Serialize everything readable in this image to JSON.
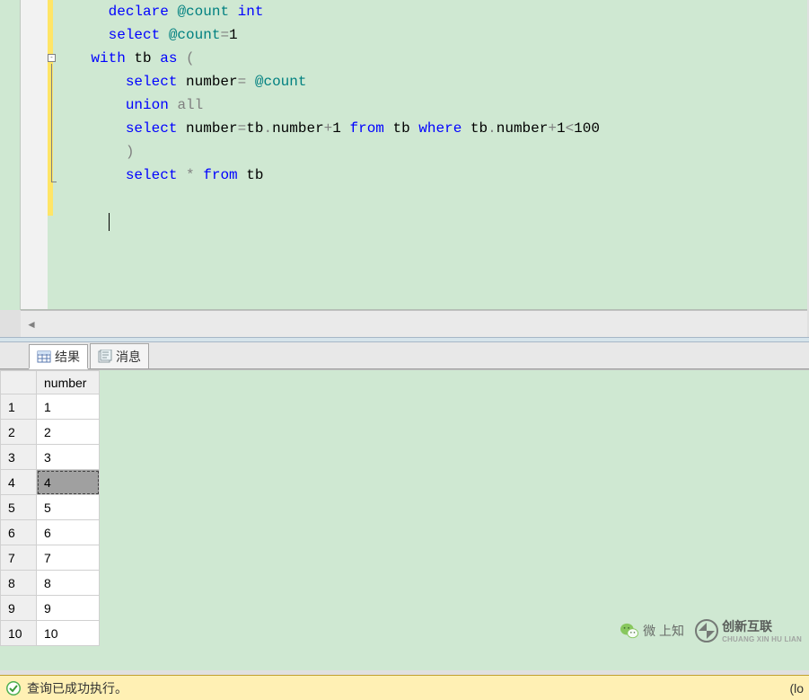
{
  "editor": {
    "lines": [
      {
        "indent": 3,
        "tokens": [
          {
            "c": "kw",
            "t": "declare"
          },
          {
            "c": "plain",
            "t": " "
          },
          {
            "c": "var",
            "t": "@count"
          },
          {
            "c": "plain",
            "t": " "
          },
          {
            "c": "kw",
            "t": "int"
          }
        ]
      },
      {
        "indent": 3,
        "tokens": [
          {
            "c": "kw",
            "t": "select"
          },
          {
            "c": "plain",
            "t": " "
          },
          {
            "c": "var",
            "t": "@count"
          },
          {
            "c": "op",
            "t": "="
          },
          {
            "c": "plain",
            "t": "1"
          }
        ]
      },
      {
        "indent": 2,
        "fold": "start",
        "tokens": [
          {
            "c": "kw",
            "t": "with"
          },
          {
            "c": "plain",
            "t": " tb "
          },
          {
            "c": "kw",
            "t": "as"
          },
          {
            "c": "plain",
            "t": " "
          },
          {
            "c": "op",
            "t": "("
          }
        ]
      },
      {
        "indent": 4,
        "tokens": [
          {
            "c": "kw",
            "t": "select"
          },
          {
            "c": "plain",
            "t": " number"
          },
          {
            "c": "op",
            "t": "="
          },
          {
            "c": "plain",
            "t": " "
          },
          {
            "c": "var",
            "t": "@count"
          }
        ]
      },
      {
        "indent": 4,
        "tokens": [
          {
            "c": "kw",
            "t": "union"
          },
          {
            "c": "plain",
            "t": " "
          },
          {
            "c": "op",
            "t": "all"
          }
        ]
      },
      {
        "indent": 4,
        "tokens": [
          {
            "c": "kw",
            "t": "select"
          },
          {
            "c": "plain",
            "t": " number"
          },
          {
            "c": "op",
            "t": "="
          },
          {
            "c": "plain",
            "t": "tb"
          },
          {
            "c": "op",
            "t": "."
          },
          {
            "c": "plain",
            "t": "number"
          },
          {
            "c": "op",
            "t": "+"
          },
          {
            "c": "plain",
            "t": "1 "
          },
          {
            "c": "kw",
            "t": "from"
          },
          {
            "c": "plain",
            "t": " tb "
          },
          {
            "c": "kw",
            "t": "where"
          },
          {
            "c": "plain",
            "t": " tb"
          },
          {
            "c": "op",
            "t": "."
          },
          {
            "c": "plain",
            "t": "number"
          },
          {
            "c": "op",
            "t": "+"
          },
          {
            "c": "plain",
            "t": "1"
          },
          {
            "c": "op",
            "t": "<"
          },
          {
            "c": "plain",
            "t": "100"
          }
        ]
      },
      {
        "indent": 4,
        "tokens": [
          {
            "c": "op",
            "t": ")"
          }
        ]
      },
      {
        "indent": 4,
        "fold": "end",
        "tokens": [
          {
            "c": "kw",
            "t": "select"
          },
          {
            "c": "plain",
            "t": " "
          },
          {
            "c": "op",
            "t": "*"
          },
          {
            "c": "plain",
            "t": " "
          },
          {
            "c": "kw",
            "t": "from"
          },
          {
            "c": "plain",
            "t": " tb"
          }
        ]
      },
      {
        "indent": 0,
        "tokens": []
      },
      {
        "indent": 3,
        "caret": true,
        "tokens": []
      }
    ]
  },
  "tabs": {
    "results": "结果",
    "messages": "消息"
  },
  "results": {
    "column_header": "number",
    "rows": [
      {
        "n": "1",
        "v": "1"
      },
      {
        "n": "2",
        "v": "2"
      },
      {
        "n": "3",
        "v": "3"
      },
      {
        "n": "4",
        "v": "4",
        "selected": true
      },
      {
        "n": "5",
        "v": "5"
      },
      {
        "n": "6",
        "v": "6"
      },
      {
        "n": "7",
        "v": "7"
      },
      {
        "n": "8",
        "v": "8"
      },
      {
        "n": "9",
        "v": "9"
      },
      {
        "n": "10",
        "v": "10"
      }
    ]
  },
  "status": {
    "text": "查询已成功执行。",
    "right": "(lo"
  },
  "watermark": {
    "wechat": "微 上知",
    "brand": "创新互联",
    "brand_sub": "CHUANG XIN HU LIAN"
  }
}
